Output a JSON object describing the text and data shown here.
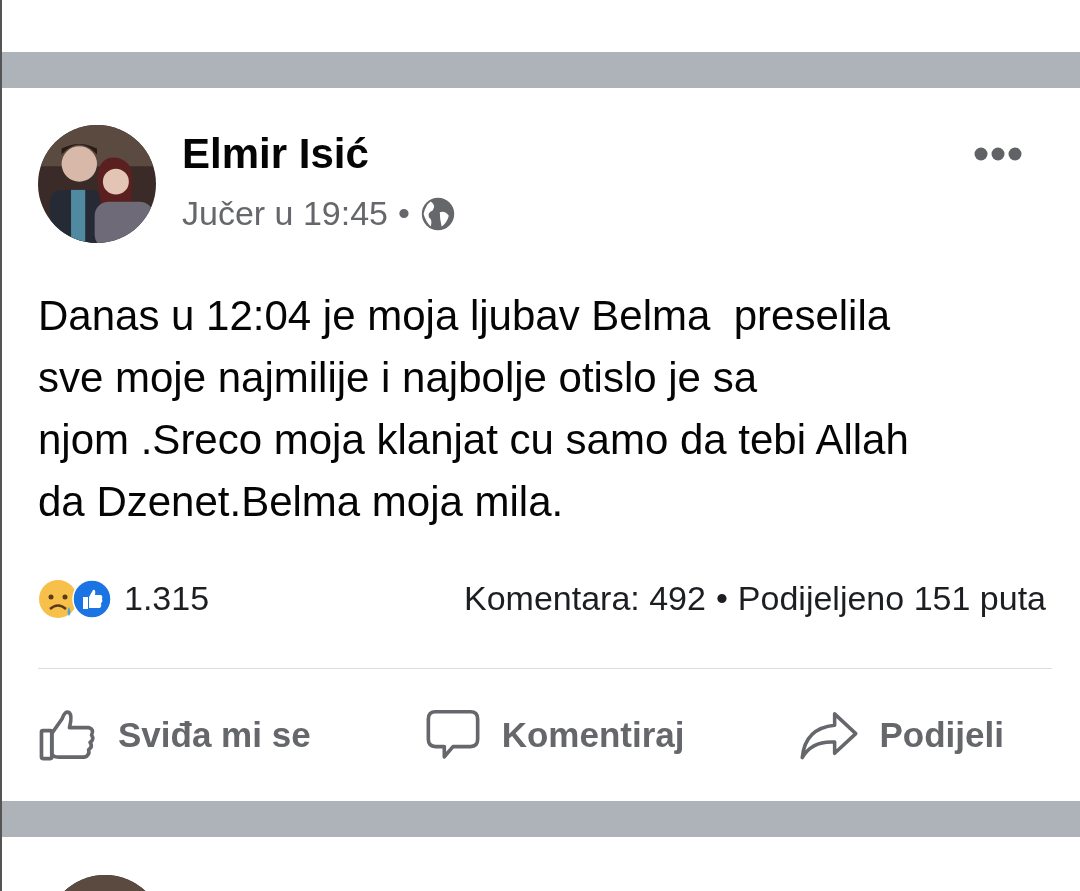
{
  "post": {
    "author": "Elmir Isić",
    "time": "Jučer u 19:45",
    "separator": "•",
    "lines": [
      "Danas u 12:04 je moja ljubav Belma  preselila",
      "sve moje najmilije i najbolje otislo je sa",
      "njom .Sreco moja klanjat cu samo da tebi Allah",
      "da Dzenet.Belma moja mila."
    ],
    "reactions_count": "1.315",
    "comments": "Komentara: 492",
    "shares_separator": "•",
    "shares": "Podijeljeno 151 puta",
    "actions": [
      {
        "kind": "like",
        "label": "Sviđa mi se"
      },
      {
        "kind": "comment",
        "label": "Komentiraj"
      },
      {
        "kind": "share",
        "label": "Podijeli"
      }
    ]
  }
}
